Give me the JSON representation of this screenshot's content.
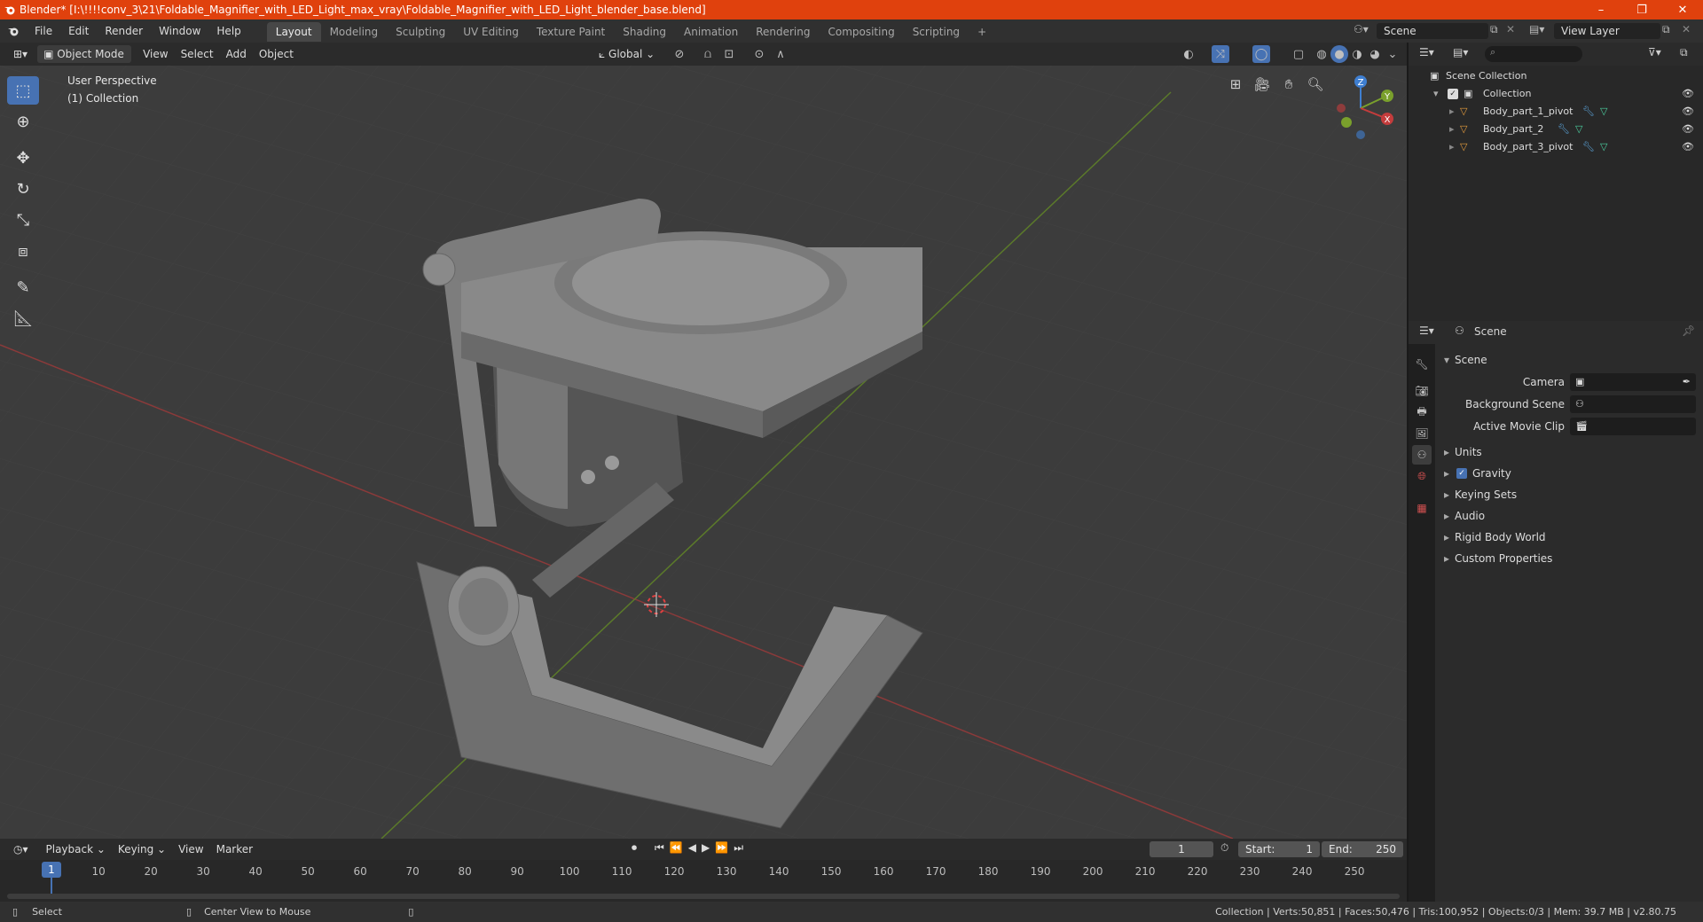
{
  "window": {
    "title": "Blender* [I:\\!!!!conv_3\\21\\Foldable_Magnifier_with_LED_Light_max_vray\\Foldable_Magnifier_with_LED_Light_blender_base.blend]",
    "minimize": "–",
    "maximize": "❐",
    "close": "✕"
  },
  "menu": [
    "File",
    "Edit",
    "Render",
    "Window",
    "Help"
  ],
  "workspaces": [
    "Layout",
    "Modeling",
    "Sculpting",
    "UV Editing",
    "Texture Paint",
    "Shading",
    "Animation",
    "Rendering",
    "Compositing",
    "Scripting"
  ],
  "workspace_add": "+",
  "scene_name": "Scene",
  "view_layer": "View Layer",
  "viewport": {
    "mode": "Object Mode",
    "menus": [
      "View",
      "Select",
      "Add",
      "Object"
    ],
    "orientation": "Global",
    "perspective_label": "User Perspective",
    "collection_label": "(1) Collection",
    "gizmo": {
      "x": "X",
      "y": "Y",
      "z": "Z"
    }
  },
  "timeline": {
    "menus": [
      "Playback",
      "Keying",
      "View",
      "Marker"
    ],
    "current_frame": "1",
    "start_label": "Start:",
    "start": "1",
    "end_label": "End:",
    "end": "250",
    "ruler": [
      {
        "label": "1",
        "frame": 1
      },
      {
        "label": "10",
        "frame": 10
      },
      {
        "label": "20",
        "frame": 20
      },
      {
        "label": "30",
        "frame": 30
      },
      {
        "label": "40",
        "frame": 40
      },
      {
        "label": "50",
        "frame": 50
      },
      {
        "label": "60",
        "frame": 60
      },
      {
        "label": "70",
        "frame": 70
      },
      {
        "label": "80",
        "frame": 80
      },
      {
        "label": "90",
        "frame": 90
      },
      {
        "label": "100",
        "frame": 100
      },
      {
        "label": "110",
        "frame": 110
      },
      {
        "label": "120",
        "frame": 120
      },
      {
        "label": "130",
        "frame": 130
      },
      {
        "label": "140",
        "frame": 140
      },
      {
        "label": "150",
        "frame": 150
      },
      {
        "label": "160",
        "frame": 160
      },
      {
        "label": "170",
        "frame": 170
      },
      {
        "label": "180",
        "frame": 180
      },
      {
        "label": "190",
        "frame": 190
      },
      {
        "label": "200",
        "frame": 200
      },
      {
        "label": "210",
        "frame": 210
      },
      {
        "label": "220",
        "frame": 220
      },
      {
        "label": "230",
        "frame": 230
      },
      {
        "label": "240",
        "frame": 240
      },
      {
        "label": "250",
        "frame": 250
      }
    ]
  },
  "outliner": {
    "root": "Scene Collection",
    "collection": "Collection",
    "objects": [
      "Body_part_1_pivot",
      "Body_part_2",
      "Body_part_3_pivot"
    ]
  },
  "properties": {
    "context": "Scene",
    "panel": "Scene",
    "fields": [
      {
        "label": "Camera"
      },
      {
        "label": "Background Scene"
      },
      {
        "label": "Active Movie Clip"
      }
    ],
    "sections": [
      "Units",
      "Gravity",
      "Keying Sets",
      "Audio",
      "Rigid Body World",
      "Custom Properties"
    ],
    "gravity_enabled": true
  },
  "status": {
    "left_action": "Select",
    "middle_action": "Center View to Mouse",
    "stats": "Collection | Verts:50,851 | Faces:50,476 | Tris:100,952 | Objects:0/3 | Mem: 39.7 MB | v2.80.75"
  },
  "colors": {
    "title_bar": "#e0410d",
    "accent": "#4772b3",
    "x_axis": "#c43c3c",
    "y_axis": "#7aa02c",
    "z_axis": "#3f7fd1"
  }
}
